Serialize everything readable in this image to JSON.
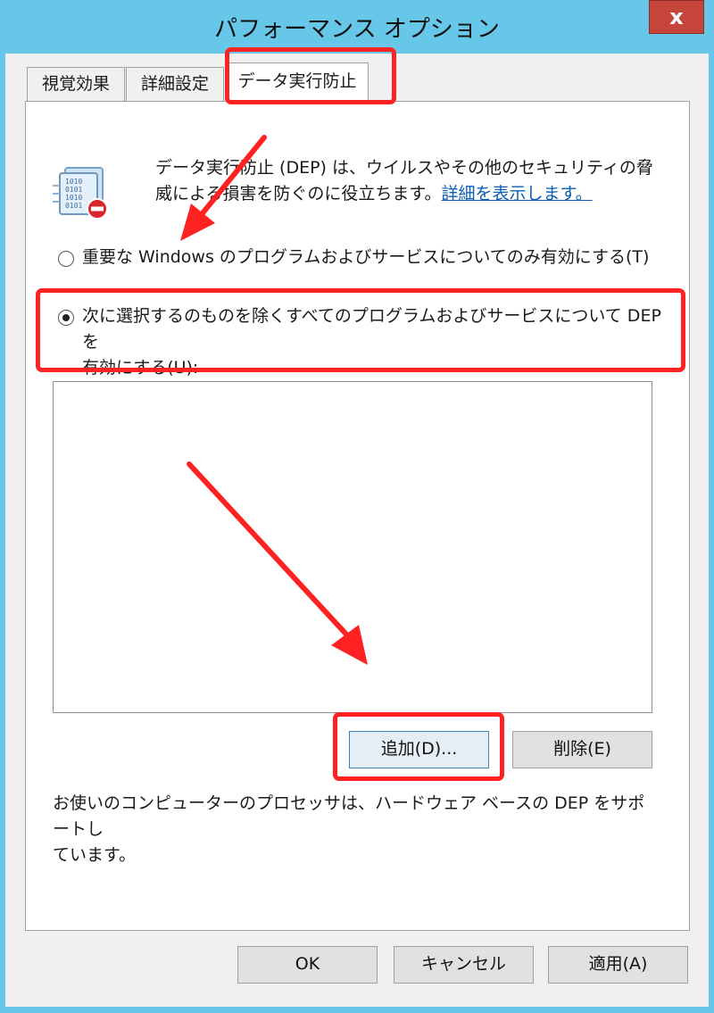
{
  "window": {
    "title": "パフォーマンス オプション",
    "close_label": "x"
  },
  "tabs": [
    {
      "label": "視覚効果",
      "active": false
    },
    {
      "label": "詳細設定",
      "active": false
    },
    {
      "label": "データ実行防止",
      "active": true
    }
  ],
  "dep": {
    "icon": "dep-shield-icon",
    "description_line1": "データ実行防止 (DEP) は、ウイルスやその他のセキュリティの脅",
    "description_line2": "威による損害を防ぐのに役立ちます。",
    "details_link": "詳細を表示します。",
    "option_essential_label": "重要な Windows のプログラムおよびサービスについてのみ有効にする(T)",
    "option_essential_selected": false,
    "option_all_label_line1": "次に選択するのものを除くすべてのプログラムおよびサービスについて DEP を",
    "option_all_label_line2": "有効にする(U):",
    "option_all_selected": true,
    "exceptions_list": [],
    "add_button": "追加(D)...",
    "remove_button": "削除(E)",
    "support_text_line1": "お使いのコンピューターのプロセッサは、ハードウェア ベースの DEP をサポートし",
    "support_text_line2": "ています。"
  },
  "footer": {
    "ok": "OK",
    "cancel": "キャンセル",
    "apply": "適用(A)"
  },
  "annotations": {
    "color": "#ff2222"
  }
}
